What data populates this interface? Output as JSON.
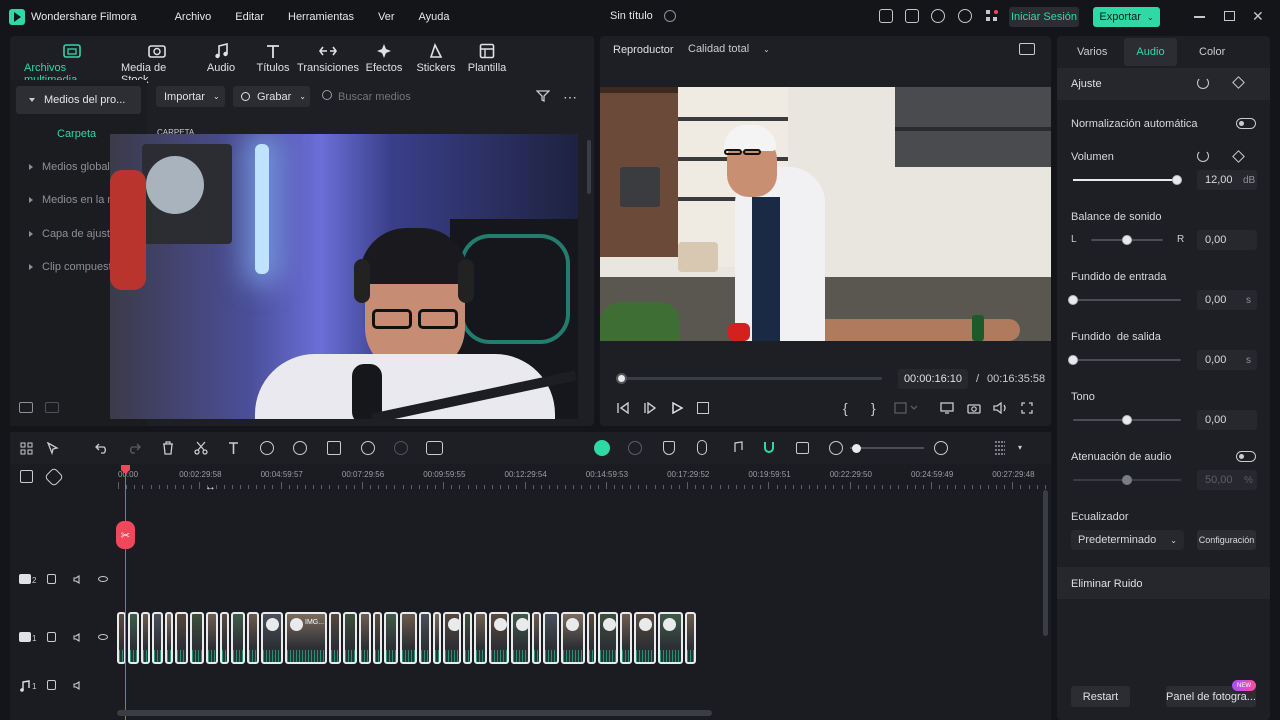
{
  "app": {
    "name": "Wondershare Filmora",
    "title": "Sin título"
  },
  "menu": [
    "Archivo",
    "Editar",
    "Herramientas",
    "Ver",
    "Ayuda"
  ],
  "header_buttons": {
    "login": "Iniciar Sesión",
    "export": "Exportar"
  },
  "media_tabs": [
    "Archivos multimedia",
    "Media de Stock",
    "Audio",
    "Títulos",
    "Transiciones",
    "Efectos",
    "Stickers",
    "Plantilla"
  ],
  "sidebar": {
    "items": [
      "Medios del pro...",
      "Carpeta",
      "Medios globale",
      "Medios en la n",
      "Capa de ajuste",
      "Clip compuesto"
    ]
  },
  "media_toolbar": {
    "import": "Importar",
    "record": "Grabar",
    "search_placeholder": "Buscar medios",
    "folder_label": "CARPETA"
  },
  "player": {
    "label": "Reproductor",
    "quality": "Calidad total",
    "current_time": "00:00:16:10",
    "separator": "/",
    "total_time": "00:16:35:58",
    "progress": 0.017
  },
  "right_tabs": [
    "Varios",
    "Audio",
    "Color"
  ],
  "audio": {
    "section": "Ajuste",
    "auto_normalization": "Normalización automática",
    "volume": {
      "label": "Volumen",
      "value": "12,00",
      "unit": "dB",
      "level": 0.96
    },
    "balance": {
      "label": "Balance de sonido",
      "left": "L",
      "right": "R",
      "value": "0,00",
      "level": 0.5
    },
    "fade_in": {
      "label": "Fundido de entrada",
      "value": "0,00",
      "unit": "s",
      "level": 0
    },
    "fade_out": {
      "label": "Fundido  de salida",
      "value": "0,00",
      "unit": "s",
      "level": 0
    },
    "pitch": {
      "label": "Tono",
      "value": "0,00",
      "level": 0.5
    },
    "ducking": {
      "label": "Atenuación de audio",
      "value": "50,00",
      "unit": "%",
      "level": 0.5
    },
    "equalizer": {
      "label": "Ecualizador",
      "preset": "Predeterminado",
      "config": "Configuración"
    },
    "denoise": "Eliminar Ruido",
    "reset": "Restart",
    "photo_panel": "Panel de fotogra...",
    "new_badge": "NEW"
  },
  "timeline": {
    "ruler": [
      "00:00",
      "00:02:29:58",
      "00:04:59:57",
      "00:07:29:56",
      "00:09:59:55",
      "00:12:29:54",
      "00:14:59:53",
      "00:17:29:52",
      "00:19:59:51",
      "00:22:29:50",
      "00:24:59:49",
      "00:27:29:48"
    ],
    "tracks": [
      "2",
      "1",
      "1"
    ],
    "clip_label": "IMG..."
  },
  "colors": {
    "accent": "#2fd9a6",
    "playhead": "#f0475b",
    "bg": "#141519",
    "panel": "#1d1f24"
  }
}
